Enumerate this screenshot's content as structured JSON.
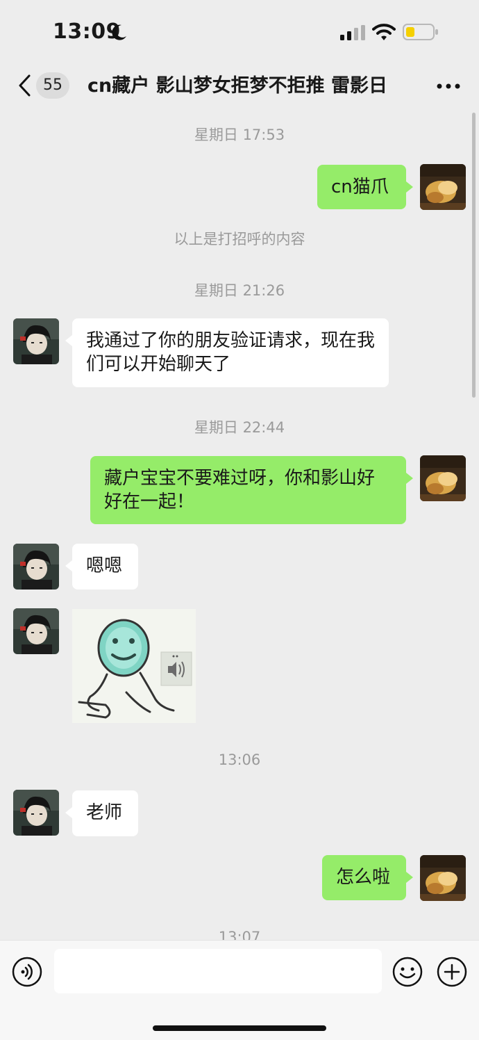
{
  "status_bar": {
    "time": "13:09",
    "icons": [
      "moon-icon",
      "signal-icon",
      "wifi-icon",
      "battery-icon"
    ],
    "battery_color": "#f5d000"
  },
  "header": {
    "unread_count": "55",
    "title": "cn藏户 影山梦女拒梦不拒推 雷影日"
  },
  "messages": [
    {
      "type": "timestamp",
      "text": "星期日 17:53"
    },
    {
      "type": "message",
      "sender": "self",
      "text": "cn猫爪"
    },
    {
      "type": "system",
      "text": "以上是打招呼的内容"
    },
    {
      "type": "timestamp",
      "text": "星期日 21:26"
    },
    {
      "type": "message",
      "sender": "other",
      "text": "我通过了你的朋友验证请求，现在我们可以开始聊天了"
    },
    {
      "type": "timestamp",
      "text": "星期日 22:44"
    },
    {
      "type": "message",
      "sender": "self",
      "text": "藏户宝宝不要难过呀，你和影山好好在一起！"
    },
    {
      "type": "message",
      "sender": "other",
      "text": "嗯嗯"
    },
    {
      "type": "sticker",
      "sender": "other",
      "icon": "sticker-face-speaker"
    },
    {
      "type": "timestamp",
      "text": "13:06"
    },
    {
      "type": "message",
      "sender": "other",
      "text": "老师"
    },
    {
      "type": "message",
      "sender": "self",
      "text": "怎么啦"
    },
    {
      "type": "timestamp",
      "text": "13:07"
    }
  ],
  "input_bar": {
    "placeholder": "",
    "value": "",
    "icons": [
      "voice-icon",
      "emoji-icon",
      "plus-icon"
    ]
  },
  "colors": {
    "background": "#ededed",
    "self_bubble": "#95ec69",
    "other_bubble": "#ffffff",
    "timestamp_text": "#9a9a9a"
  }
}
